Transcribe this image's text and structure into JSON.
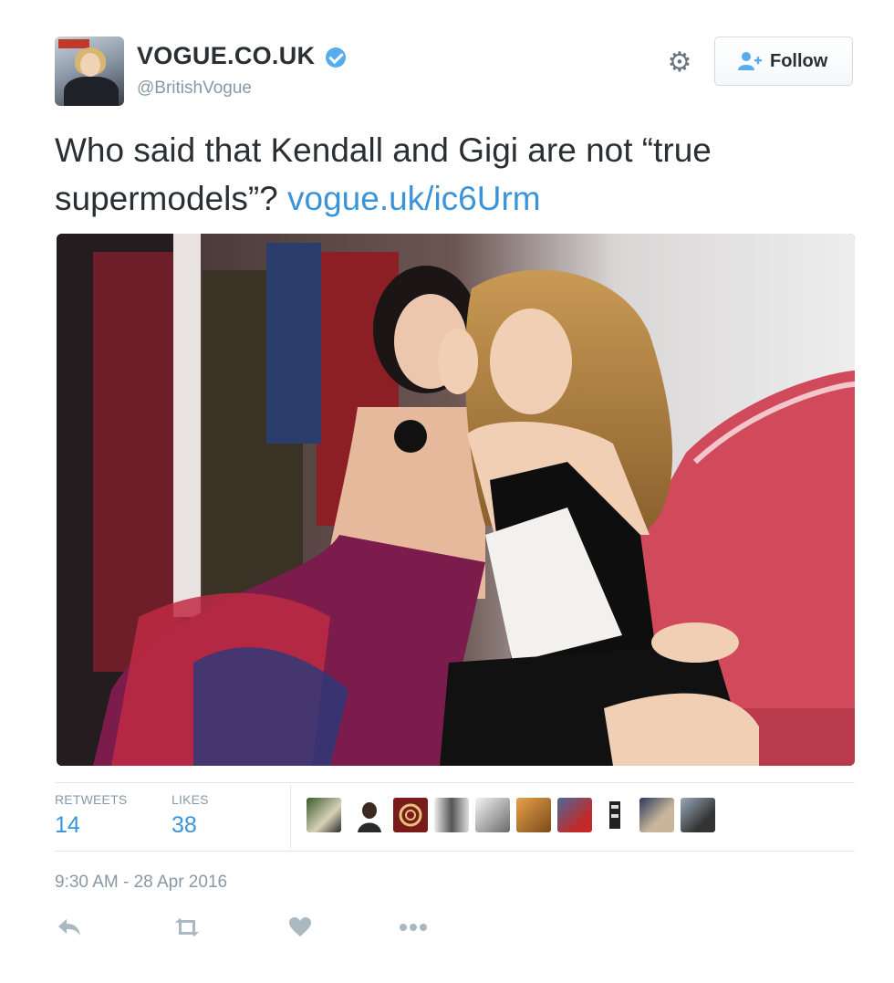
{
  "account": {
    "name": "VOGUE.CO.UK",
    "handle": "@BritishVogue",
    "verified": true
  },
  "follow_button": {
    "label": "Follow"
  },
  "tweet": {
    "text": "Who said that Kendall and Gigi are not “true supermodels”? ",
    "link_text": "vogue.uk/ic6Urm"
  },
  "stats": {
    "retweets_label": "RETWEETS",
    "retweets_count": "14",
    "likes_label": "LIKES",
    "likes_count": "38"
  },
  "timestamp": "9:30 AM - 28 Apr 2016",
  "icons": {
    "settings": "gear-icon",
    "follow": "add-user-icon",
    "reply": "reply-icon",
    "retweet": "retweet-icon",
    "like": "heart-icon",
    "more": "more-icon"
  },
  "colors": {
    "link": "#3b94d9",
    "verified": "#55acee",
    "text": "#292f33",
    "muted": "#8899a6",
    "sofa": "#d14a5c"
  }
}
